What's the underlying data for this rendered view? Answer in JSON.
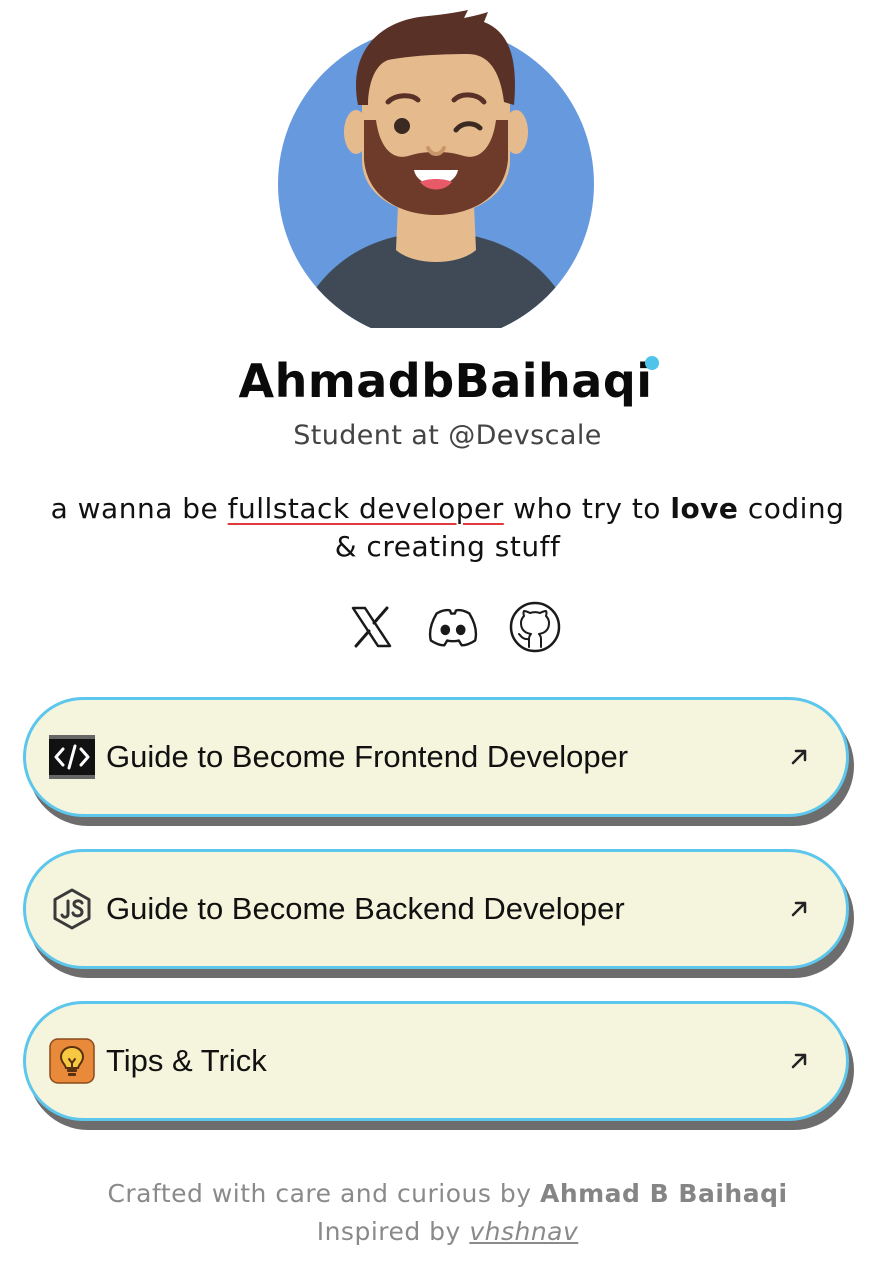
{
  "profile": {
    "name": "AhmadbBaihaqi",
    "role": "Student at @Devscale",
    "bio": {
      "part1": "a wanna be ",
      "highlight": "fullstack developer",
      "part2": " who try to ",
      "bold": "love",
      "part3": " coding & creating stuff"
    },
    "avatar_icon": "avatar-illustration"
  },
  "socials": [
    {
      "icon": "x-twitter-icon"
    },
    {
      "icon": "discord-icon"
    },
    {
      "icon": "github-icon"
    }
  ],
  "links": [
    {
      "label": "Guide to Become Frontend Developer",
      "icon": "code-terminal-icon"
    },
    {
      "label": "Guide to Become Backend Developer",
      "icon": "nodejs-icon"
    },
    {
      "label": "Tips & Trick",
      "icon": "lightbulb-icon"
    }
  ],
  "footer": {
    "line1_prefix": "Crafted with care and curious by ",
    "line1_author": "Ahmad B Baihaqi",
    "line2_prefix": "Inspired by ",
    "line2_link": "vhshnav"
  },
  "colors": {
    "card_background": "#f5f4dc",
    "card_border": "#5cc6ec",
    "card_shadow": "#6d6d6d",
    "avatar_background": "#6699dd",
    "bio_underline": "#e0393e",
    "name_dot": "#4fc3ea"
  }
}
